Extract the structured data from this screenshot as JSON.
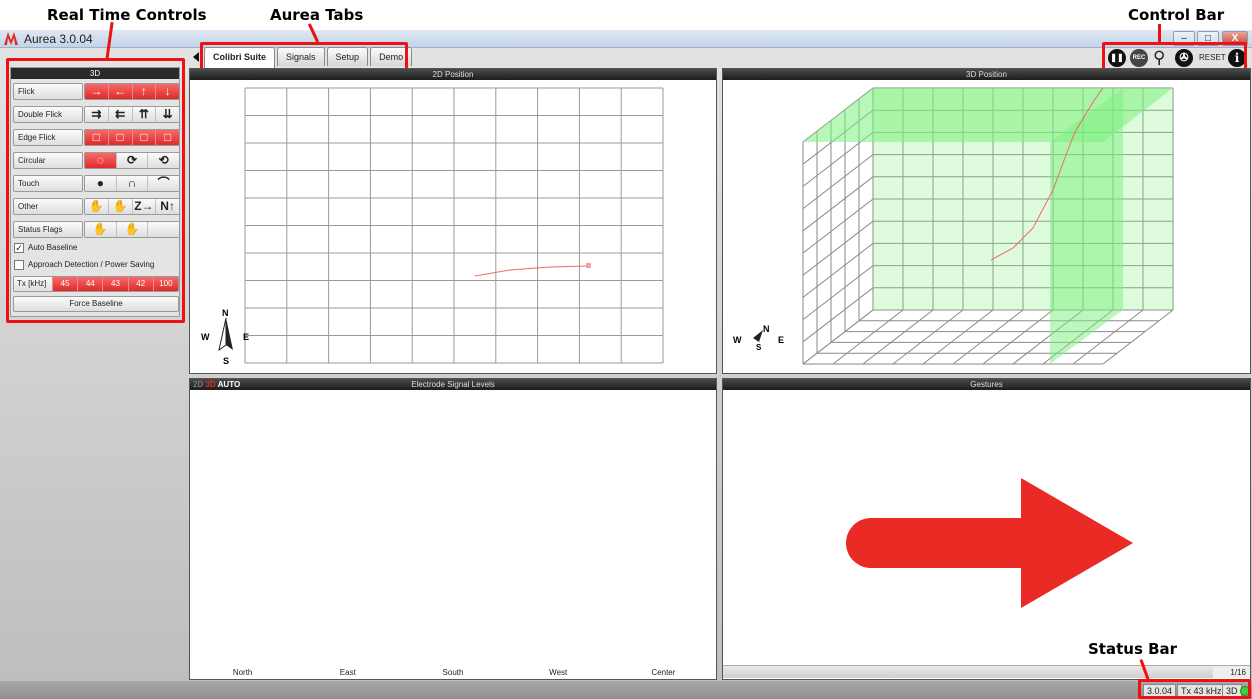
{
  "callouts": {
    "realtime": "Real Time Controls",
    "tabs": "Aurea Tabs",
    "controlbar": "Control Bar",
    "statusbar": "Status Bar"
  },
  "window": {
    "title": "Aurea 3.0.04",
    "min": "–",
    "max": "□",
    "close": "X"
  },
  "left": {
    "header": "3D",
    "rows": [
      {
        "label": "Flick",
        "buttons": [
          "→",
          "←",
          "↑",
          "↓"
        ],
        "on": [
          true,
          true,
          true,
          true
        ]
      },
      {
        "label": "Double Flick",
        "buttons": [
          "⇉",
          "⇇",
          "⇈",
          "⇊"
        ],
        "on": [
          false,
          false,
          false,
          false
        ]
      },
      {
        "label": "Edge Flick",
        "buttons": [
          "□",
          "□",
          "□",
          "□"
        ],
        "on": [
          true,
          true,
          true,
          true
        ]
      },
      {
        "label": "Circular",
        "buttons": [
          "◌",
          "⟳",
          "⟲"
        ],
        "on": [
          true,
          false,
          false
        ]
      },
      {
        "label": "Touch",
        "buttons": [
          "●",
          "∩",
          "⌒"
        ],
        "on": [
          false,
          false,
          false
        ]
      },
      {
        "label": "Other",
        "buttons": [
          "✋",
          "✋",
          "Z→",
          "N↑"
        ],
        "on": [
          false,
          false,
          false,
          false
        ]
      },
      {
        "label": "Status Flags",
        "buttons": [
          "✋",
          "✋",
          ""
        ],
        "on": [
          false,
          false,
          false
        ]
      }
    ],
    "auto_baseline": "Auto Baseline",
    "approach": "Approach Detection / Power Saving",
    "tx_label": "Tx [kHz]",
    "tx_values": [
      "45",
      "44",
      "43",
      "42",
      "100"
    ],
    "force_baseline": "Force Baseline"
  },
  "tabs": [
    "Colibri Suite",
    "Signals",
    "Setup",
    "Demo"
  ],
  "controlbar": {
    "rec": "REC",
    "reset": "RESET",
    "info": "i"
  },
  "panels": {
    "pos2d": "2D Position",
    "pos3d": "3D Position",
    "electrode": "Electrode Signal Levels",
    "gestures": "Gestures"
  },
  "electrode_mode": {
    "m2d": "2D",
    "m3d": "3D",
    "auto": "AUTO"
  },
  "electrodes": [
    "North",
    "East",
    "South",
    "West",
    "Center"
  ],
  "compass": {
    "n": "N",
    "s": "S",
    "e": "E",
    "w": "W"
  },
  "gesture_page": "1/16",
  "status": {
    "version": "3.0.04",
    "tx": "Tx 43 kHz",
    "mode": "3D"
  }
}
